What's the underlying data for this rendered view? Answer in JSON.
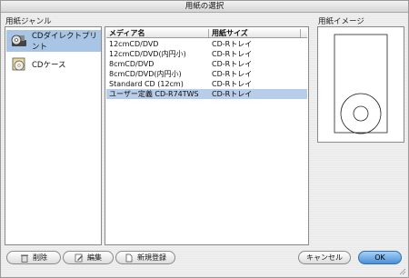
{
  "window": {
    "title": "用紙の選択"
  },
  "genre": {
    "label": "用紙ジャンル",
    "items": [
      {
        "label": "CDダイレクトプリント",
        "icon": "cd-direct-print-icon",
        "selected": true
      },
      {
        "label": "CDケース",
        "icon": "cd-case-icon",
        "selected": false
      }
    ]
  },
  "media_list": {
    "columns": [
      "メディア名",
      "用紙サイズ"
    ],
    "rows": [
      {
        "name": "12cmCD/DVD",
        "size": "CD-Rトレイ"
      },
      {
        "name": "12cmCD/DVD(内円小)",
        "size": "CD-Rトレイ"
      },
      {
        "name": "8cmCD/DVD",
        "size": "CD-Rトレイ"
      },
      {
        "name": "8cmCD/DVD(内円小)",
        "size": "CD-Rトレイ"
      },
      {
        "name": "Standard CD (12cm)",
        "size": "CD-Rトレイ"
      },
      {
        "name": "ユーザー定義 CD-R74TWS",
        "size": "CD-Rトレイ",
        "selected": true
      }
    ]
  },
  "preview": {
    "label": "用紙イメージ"
  },
  "buttons": {
    "delete": "削除",
    "edit": "編集",
    "new_register": "新規登録",
    "cancel": "キャンセル",
    "ok": "OK"
  },
  "colors": {
    "selection": "#a9c5e6",
    "ok_button": "#4a90d8"
  }
}
